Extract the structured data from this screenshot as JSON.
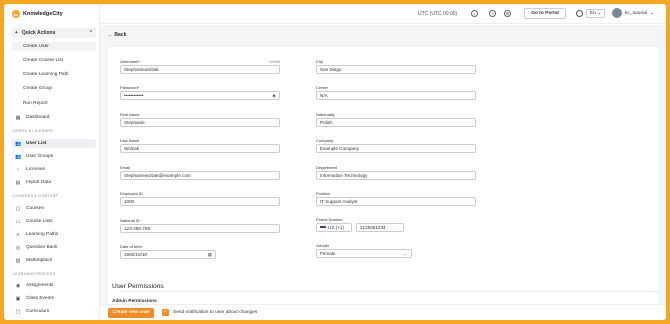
{
  "brand": {
    "name": "KnowledgeCity",
    "accent": "#f28c28",
    "frame_color": "#f5a623"
  },
  "sidebar": {
    "quick_actions": {
      "label": "Quick Actions",
      "items": [
        "Create User",
        "Create Course List",
        "Create Learning Path",
        "Create Group",
        "Run Report"
      ]
    },
    "dashboard": "Dashboard",
    "sections": {
      "users": {
        "label": "USERS & LICENSES",
        "items": [
          "User List",
          "User Groups",
          "Licenses",
          "Import Data"
        ]
      },
      "courses": {
        "label": "COURSES & CONTENT",
        "items": [
          "Courses",
          "Course Lists",
          "Learning Paths",
          "Question Bank",
          "Marketplace"
        ]
      },
      "learning": {
        "label": "LEARNING PROCESS",
        "items": [
          "Assignments",
          "Class Events",
          "Curriculum"
        ]
      }
    }
  },
  "topbar": {
    "utc": "UTC (UTC 00:00)",
    "portal": "Go to Portal",
    "lang": "En",
    "user": "kc_tutorial"
  },
  "main": {
    "back": "Back",
    "form": {
      "username": {
        "label": "Username*",
        "value": "Stephaniewolzak",
        "counter": "15/256"
      },
      "password": {
        "label": "Password*",
        "value": "••••••••••••"
      },
      "first_name": {
        "label": "First Name",
        "value": "Stephanie"
      },
      "last_name": {
        "label": "Last Name",
        "value": "Wolzak"
      },
      "email": {
        "label": "Email",
        "value": "Stephaniewolzak@example.com"
      },
      "employee_id": {
        "label": "Employee ID",
        "value": "1000"
      },
      "national_id": {
        "label": "National ID",
        "value": "123-456-789"
      },
      "dob": {
        "label": "Date of birth",
        "value": "1992/10/10"
      },
      "city": {
        "label": "City",
        "value": "San Diego"
      },
      "center": {
        "label": "Center",
        "value": "N/A"
      },
      "nationality": {
        "label": "Nationality",
        "value": "Polish"
      },
      "company": {
        "label": "Company",
        "value": "Example Company"
      },
      "department": {
        "label": "Department",
        "value": "Information Technology"
      },
      "position": {
        "label": "Position",
        "value": "IT Support Analyst"
      },
      "phone": {
        "label": "Phone Number",
        "code": "US (+1)",
        "value": "2125551234"
      },
      "gender": {
        "label": "Gender",
        "value": "Female"
      }
    },
    "permissions_title": "User Permissions",
    "admin_permissions": "Admin Permissions"
  },
  "footer": {
    "create": "Create new user",
    "notify": "Send notification to user about changes"
  }
}
